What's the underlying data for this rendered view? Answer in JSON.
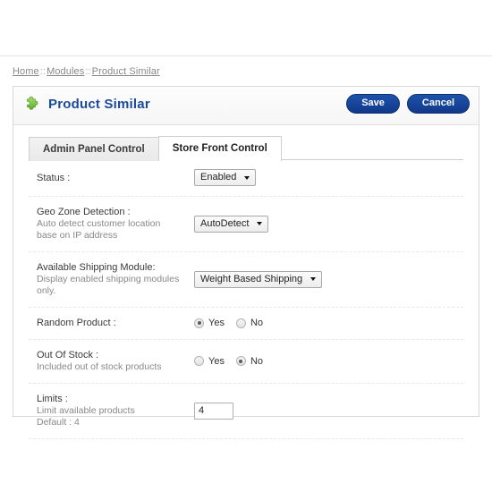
{
  "breadcrumb": {
    "items": [
      "Home",
      "Modules",
      "Product Similar"
    ],
    "separator": "::"
  },
  "panel": {
    "title": "Product Similar",
    "icon": "puzzle-piece-icon",
    "accent_color": "#1a4a9c",
    "button_color": "#1e53ab",
    "actions": {
      "save_label": "Save",
      "cancel_label": "Cancel"
    }
  },
  "tabs": [
    {
      "label": "Admin Panel Control",
      "active": false
    },
    {
      "label": "Store Front Control",
      "active": true
    }
  ],
  "form": {
    "rows": [
      {
        "label": "Status :",
        "sublabel": "",
        "sublabel2": "",
        "control": "select",
        "value": "Enabled"
      },
      {
        "label": "Geo Zone Detection :",
        "sublabel": "Auto detect customer location",
        "sublabel2": "base on IP address",
        "control": "select",
        "value": "AutoDetect"
      },
      {
        "label": "Available Shipping Module:",
        "sublabel": "Display enabled shipping modules",
        "sublabel2": "only.",
        "control": "select",
        "value": "Weight Based Shipping"
      },
      {
        "label": "Random Product :",
        "sublabel": "",
        "sublabel2": "",
        "control": "radio",
        "options": [
          "Yes",
          "No"
        ],
        "value": "Yes"
      },
      {
        "label": "Out Of Stock :",
        "sublabel": "Included out of stock products",
        "sublabel2": "",
        "control": "radio",
        "options": [
          "Yes",
          "No"
        ],
        "value": "No"
      },
      {
        "label": "Limits :",
        "sublabel": "Limit available products",
        "sublabel2": "Default : 4",
        "control": "text",
        "value": "4"
      }
    ]
  }
}
